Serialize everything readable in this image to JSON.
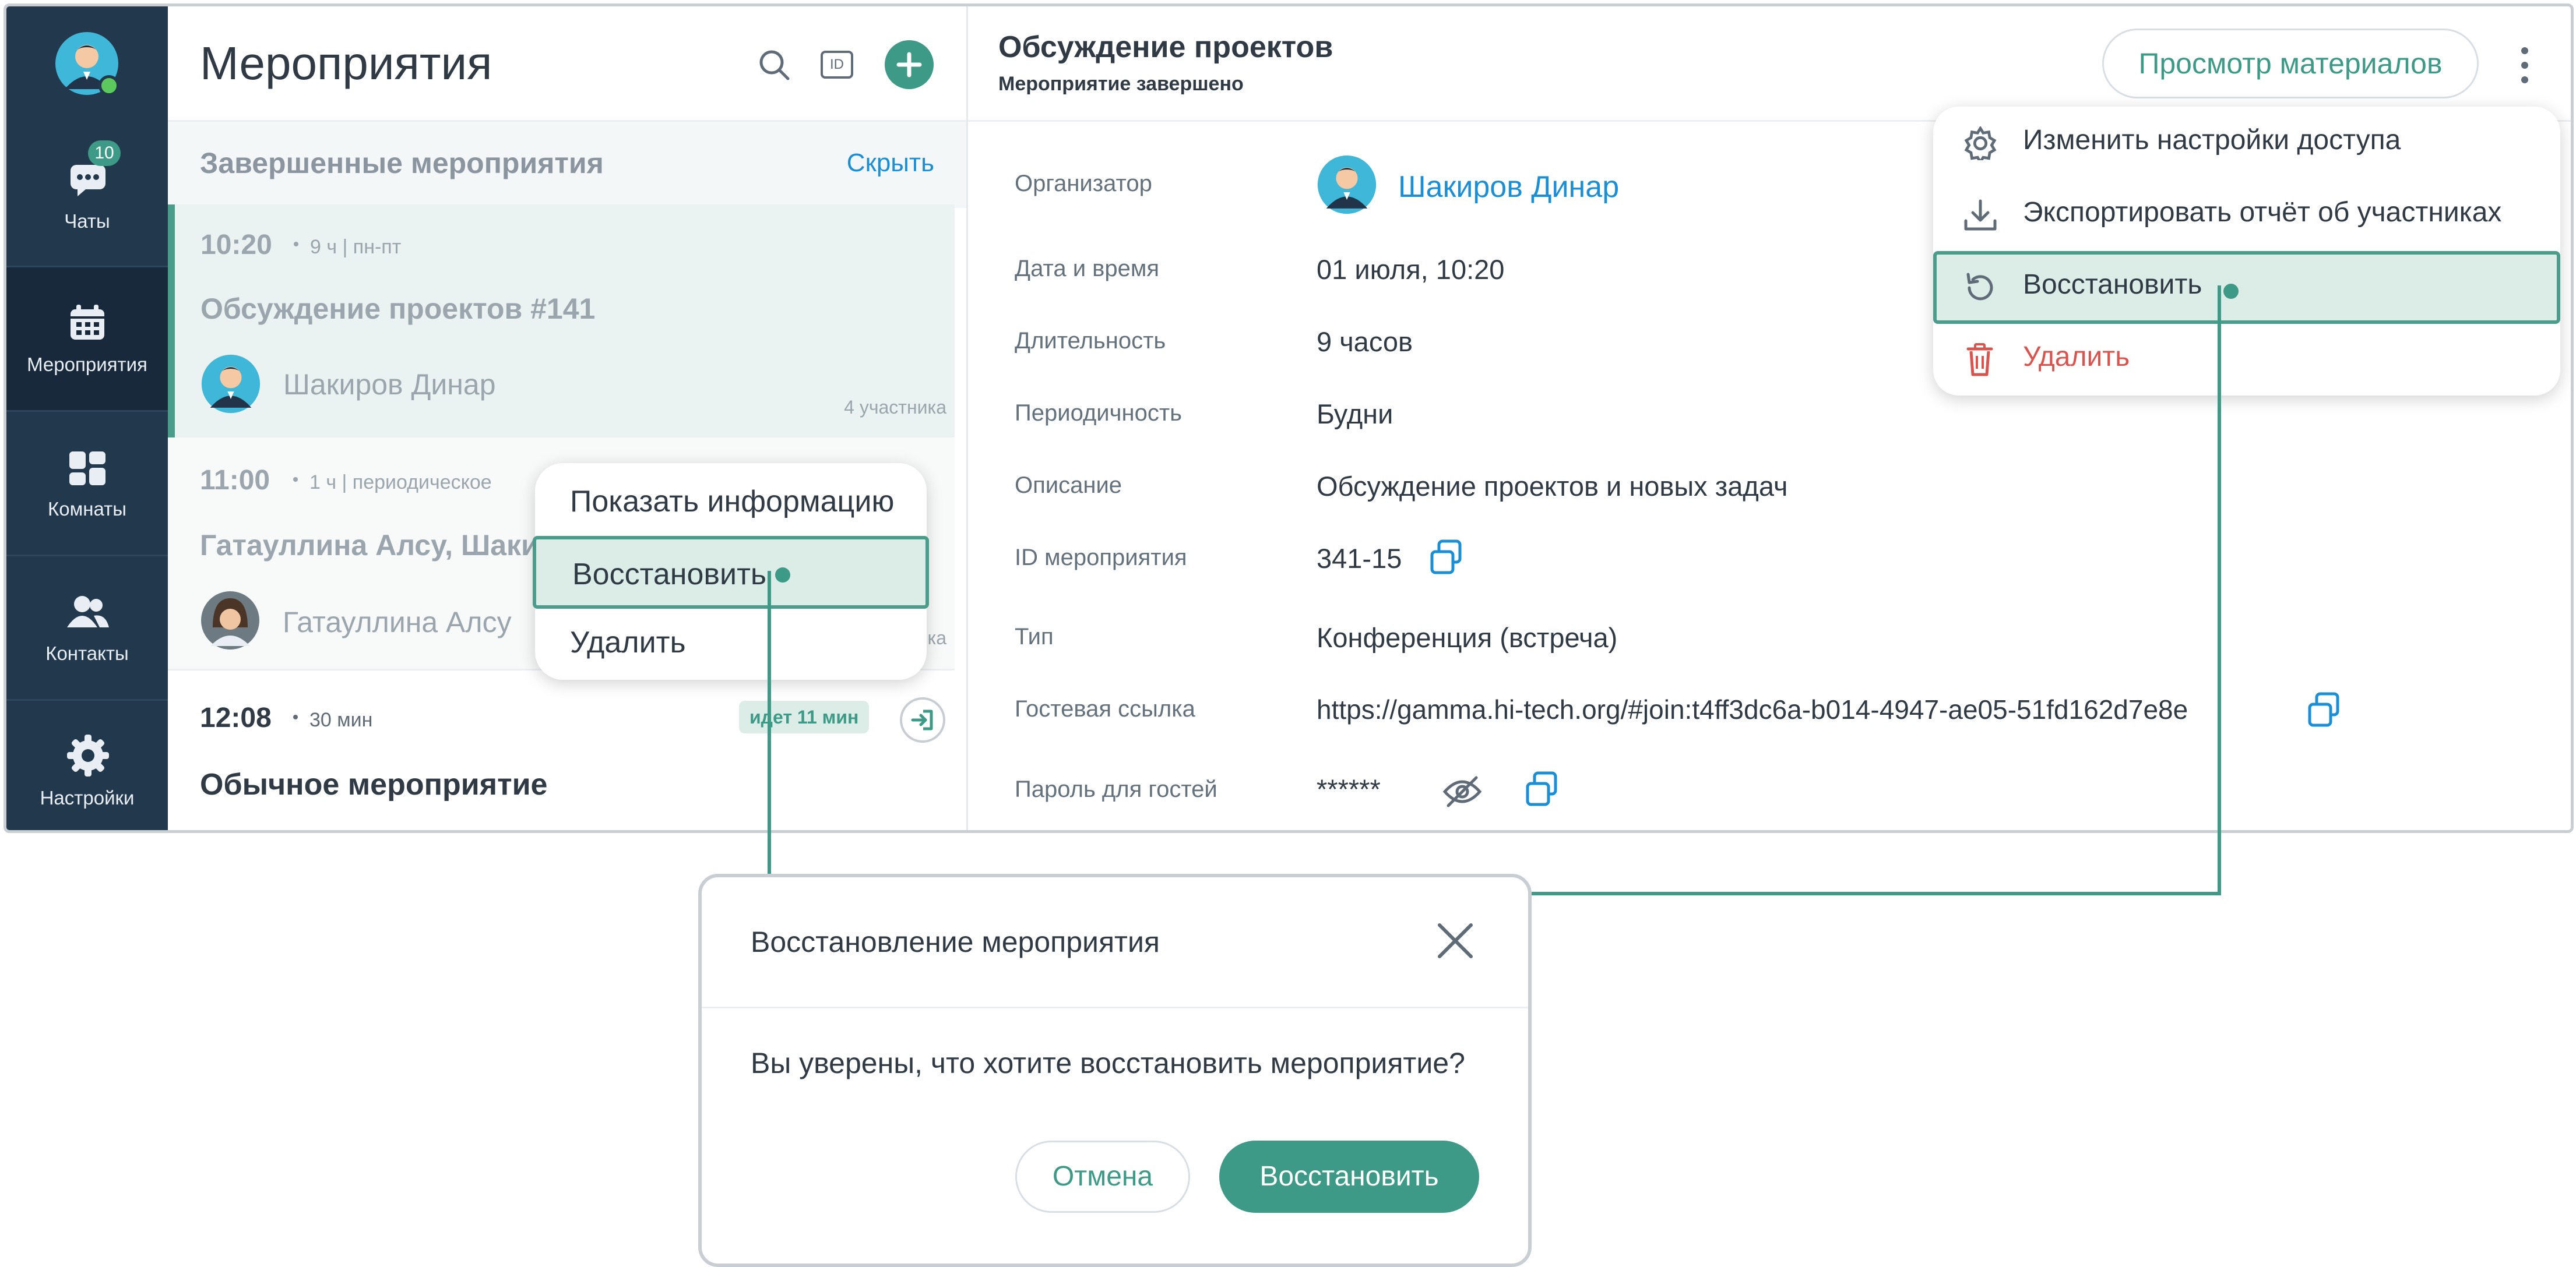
{
  "sidebar": {
    "chats_label": "Чаты",
    "chats_badge": "10",
    "events_label": "Мероприятия",
    "rooms_label": "Комнаты",
    "contacts_label": "Контакты",
    "settings_label": "Настройки"
  },
  "list": {
    "title": "Мероприятия",
    "id_button": "ID",
    "section_title": "Завершенные мероприятия",
    "section_hide": "Скрыть",
    "events": [
      {
        "time": "10:20",
        "meta": "9 ч | пн-пт",
        "title": "Обсуждение проектов #141",
        "person": "Шакиров Динар",
        "participants": "4 участника"
      },
      {
        "time": "11:00",
        "meta": "1 ч | периодическое",
        "title": "Гатауллина Алсу, Шаки",
        "person": "Гатауллина Алсу",
        "participants": "ка"
      },
      {
        "time": "12:08",
        "meta": "30 мин",
        "title": "Обычное мероприятие",
        "status": "идет 11 мин"
      }
    ]
  },
  "context_menu": {
    "items": [
      "Показать информацию",
      "Восстановить",
      "Удалить"
    ]
  },
  "detail": {
    "title": "Обсуждение проектов",
    "subtitle": "Мероприятие завершено",
    "view_materials": "Просмотр материалов",
    "fields": {
      "organizer_label": "Организатор",
      "organizer_value": "Шакиров Динар",
      "datetime_label": "Дата и время",
      "datetime_value": "01 июля, 10:20",
      "duration_label": "Длительность",
      "duration_value": "9 часов",
      "periodicity_label": "Периодичность",
      "periodicity_value": "Будни",
      "description_label": "Описание",
      "description_value": "Обсуждение проектов и новых задач",
      "id_label": "ID мероприятия",
      "id_value": "341-15",
      "type_label": "Тип",
      "type_value": "Конференция (встреча)",
      "guest_link_label": "Гостевая ссылка",
      "guest_link_value": "https://gamma.hi-tech.org/#join:t4ff3dc6a-b014-4947-ae05-51fd162d7e8e",
      "guest_password_label": "Пароль для гостей",
      "guest_password_value": "******"
    }
  },
  "more_menu": {
    "items": [
      "Изменить настройки доступа",
      "Экспортировать отчёт об участниках",
      "Восстановить",
      "Удалить"
    ]
  },
  "dialog": {
    "title": "Восстановление мероприятия",
    "message": "Вы уверены, что хотите восстановить мероприятие?",
    "cancel": "Отмена",
    "confirm": "Восстановить"
  },
  "colors": {
    "accent": "#3d9a86",
    "link": "#1b8fd6",
    "danger": "#d9534f",
    "sidebar": "#22384c"
  }
}
